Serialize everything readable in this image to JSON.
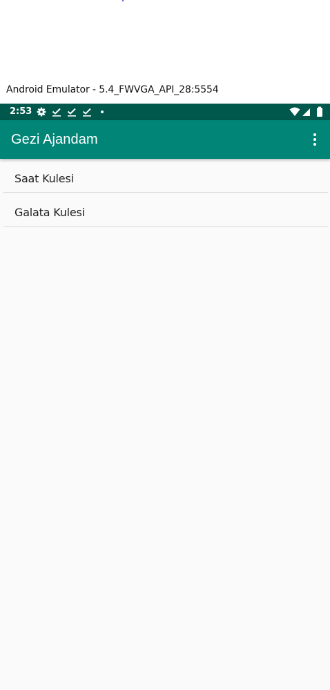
{
  "window": {
    "title": "Android Emulator - 5.4_FWVGA_API_28:5554"
  },
  "status_bar": {
    "time": "2:53",
    "left_icons": [
      "settings-icon",
      "checkmark-icon",
      "checkmark-icon",
      "checkmark-icon",
      "dot-icon"
    ],
    "right_icons": [
      "wifi-icon",
      "cellular-signal-icon",
      "battery-icon"
    ]
  },
  "app_bar": {
    "title": "Gezi Ajandam",
    "overflow_icon": "more-vert-icon"
  },
  "list": {
    "items": [
      {
        "label": "Saat Kulesi"
      },
      {
        "label": "Galata Kulesi"
      }
    ]
  },
  "colors": {
    "status_bar": "#00574B",
    "app_bar": "#008577",
    "background": "#FAFAFA",
    "divider": "#DCDCDC",
    "text_primary": "#212121"
  }
}
